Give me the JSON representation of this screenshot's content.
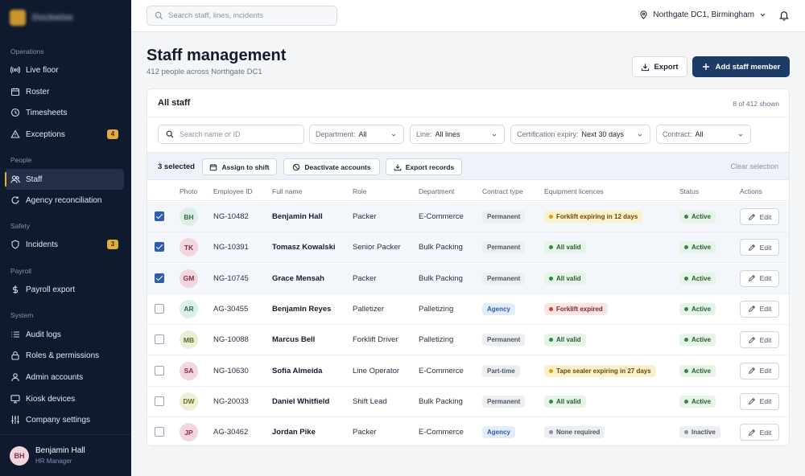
{
  "brand": {
    "name": "Dockwise"
  },
  "sidebar": {
    "groups": [
      {
        "label": "Operations"
      },
      {
        "label": "People"
      },
      {
        "label": "Safety"
      },
      {
        "label": "Payroll"
      },
      {
        "label": "System"
      }
    ],
    "items": [
      {
        "label": "Live floor",
        "icon": "radio-signal-icon"
      },
      {
        "label": "Roster",
        "icon": "calendar-icon"
      },
      {
        "label": "Timesheets",
        "icon": "clock-icon"
      },
      {
        "label": "Exceptions",
        "icon": "warning-triangle-icon",
        "badge": "4"
      },
      {
        "label": "Staff",
        "icon": "users-icon",
        "active": true
      },
      {
        "label": "Agency reconciliation",
        "icon": "refresh-icon"
      },
      {
        "label": "Incidents",
        "icon": "shield-icon",
        "badge": "3"
      },
      {
        "label": "Payroll export",
        "icon": "dollar-icon"
      },
      {
        "label": "Audit logs",
        "icon": "list-icon"
      },
      {
        "label": "Roles & permissions",
        "icon": "lock-icon"
      },
      {
        "label": "Admin accounts",
        "icon": "user-icon"
      },
      {
        "label": "Kiosk devices",
        "icon": "monitor-icon"
      },
      {
        "label": "Company settings",
        "icon": "sliders-icon"
      }
    ],
    "user": {
      "initials": "BH",
      "name": "Benjamin Hall",
      "role": "HR Manager"
    }
  },
  "topbar": {
    "search_placeholder": "Search staff, lines, incidents",
    "site": "Northgate DC1, Birmingham"
  },
  "page": {
    "title": "Staff management",
    "subtitle": "412 people across Northgate DC1",
    "export_label": "Export",
    "add_label": "Add staff member"
  },
  "card": {
    "title": "All staff",
    "count": "8 of 412 shown",
    "search_placeholder": "Search name or ID",
    "filters": [
      {
        "label": "Department:",
        "value": "All"
      },
      {
        "label": "Line:",
        "value": "All lines"
      },
      {
        "label": "Certification expiry:",
        "value": "Next 30 days"
      },
      {
        "label": "Contract:",
        "value": "All"
      }
    ],
    "selection": {
      "count": "3 selected",
      "assign": "Assign to shift",
      "deactivate": "Deactivate accounts",
      "export": "Export records",
      "clear": "Clear selection"
    }
  },
  "table": {
    "columns": [
      "Photo",
      "Employee ID",
      "Full name",
      "Role",
      "Department",
      "Contract type",
      "Equipment licences",
      "Status",
      "Actions"
    ],
    "edit_label": "Edit",
    "rows": [
      {
        "checked": true,
        "initials": "BH",
        "av_bg": "#dcefe6",
        "av_fg": "#2c6b4f",
        "id": "NG-10482",
        "name": "Benjamin Hall",
        "role": "Packer",
        "dept": "E-Commerce",
        "contract": "Permanent",
        "licence": "Forklift expiring in 12 days",
        "licence_kind": "warn",
        "status": "Active"
      },
      {
        "checked": true,
        "initials": "TK",
        "av_bg": "#f1d6de",
        "av_fg": "#8a2c4d",
        "id": "NG-10391",
        "name": "Tomasz Kowalski",
        "role": "Senior Packer",
        "dept": "Bulk Packing",
        "contract": "Permanent",
        "licence": "All valid",
        "licence_kind": "ok",
        "status": "Active"
      },
      {
        "checked": true,
        "initials": "GM",
        "av_bg": "#f1d6de",
        "av_fg": "#8a2c4d",
        "id": "NG-10745",
        "name": "Grace Mensah",
        "role": "Packer",
        "dept": "Bulk Packing",
        "contract": "Permanent",
        "licence": "All valid",
        "licence_kind": "ok",
        "status": "Active"
      },
      {
        "checked": false,
        "initials": "AR",
        "av_bg": "#dcefe6",
        "av_fg": "#2c6b4f",
        "id": "AG-30455",
        "name": "Benjamin Reyes",
        "role": "Palletizer",
        "dept": "Palletizing",
        "contract": "Agency",
        "licence": "Forklift expired",
        "licence_kind": "bad",
        "status": "Active"
      },
      {
        "checked": false,
        "initials": "MB",
        "av_bg": "#e8efd5",
        "av_fg": "#56672a",
        "id": "NG-10088",
        "name": "Marcus Bell",
        "role": "Forklift Driver",
        "dept": "Palletizing",
        "contract": "Permanent",
        "licence": "All valid",
        "licence_kind": "ok",
        "status": "Active"
      },
      {
        "checked": false,
        "initials": "SA",
        "av_bg": "#f1d6de",
        "av_fg": "#8a2c4d",
        "id": "NG-10630",
        "name": "Sofia Almeida",
        "role": "Line Operator",
        "dept": "E-Commerce",
        "contract": "Part-time",
        "licence": "Tape sealer expiring in 27 days",
        "licence_kind": "warn",
        "status": "Active"
      },
      {
        "checked": false,
        "initials": "DW",
        "av_bg": "#eef0d3",
        "av_fg": "#6b6a22",
        "id": "NG-20033",
        "name": "Daniel Whitfield",
        "role": "Shift Lead",
        "dept": "Bulk Packing",
        "contract": "Permanent",
        "licence": "All valid",
        "licence_kind": "ok",
        "status": "Active"
      },
      {
        "checked": false,
        "initials": "JP",
        "av_bg": "#f1d6de",
        "av_fg": "#8a2c4d",
        "id": "AG-30462",
        "name": "Jordan Pike",
        "role": "Packer",
        "dept": "E-Commerce",
        "contract": "Agency",
        "licence": "None required",
        "licence_kind": "none",
        "status": "Inactive"
      }
    ]
  },
  "colors": {
    "accent": "#1e3a66",
    "sidebar_bg": "#0f1a2e",
    "badge": "#e3ad3d",
    "checkbox": "#2d5fa8"
  }
}
